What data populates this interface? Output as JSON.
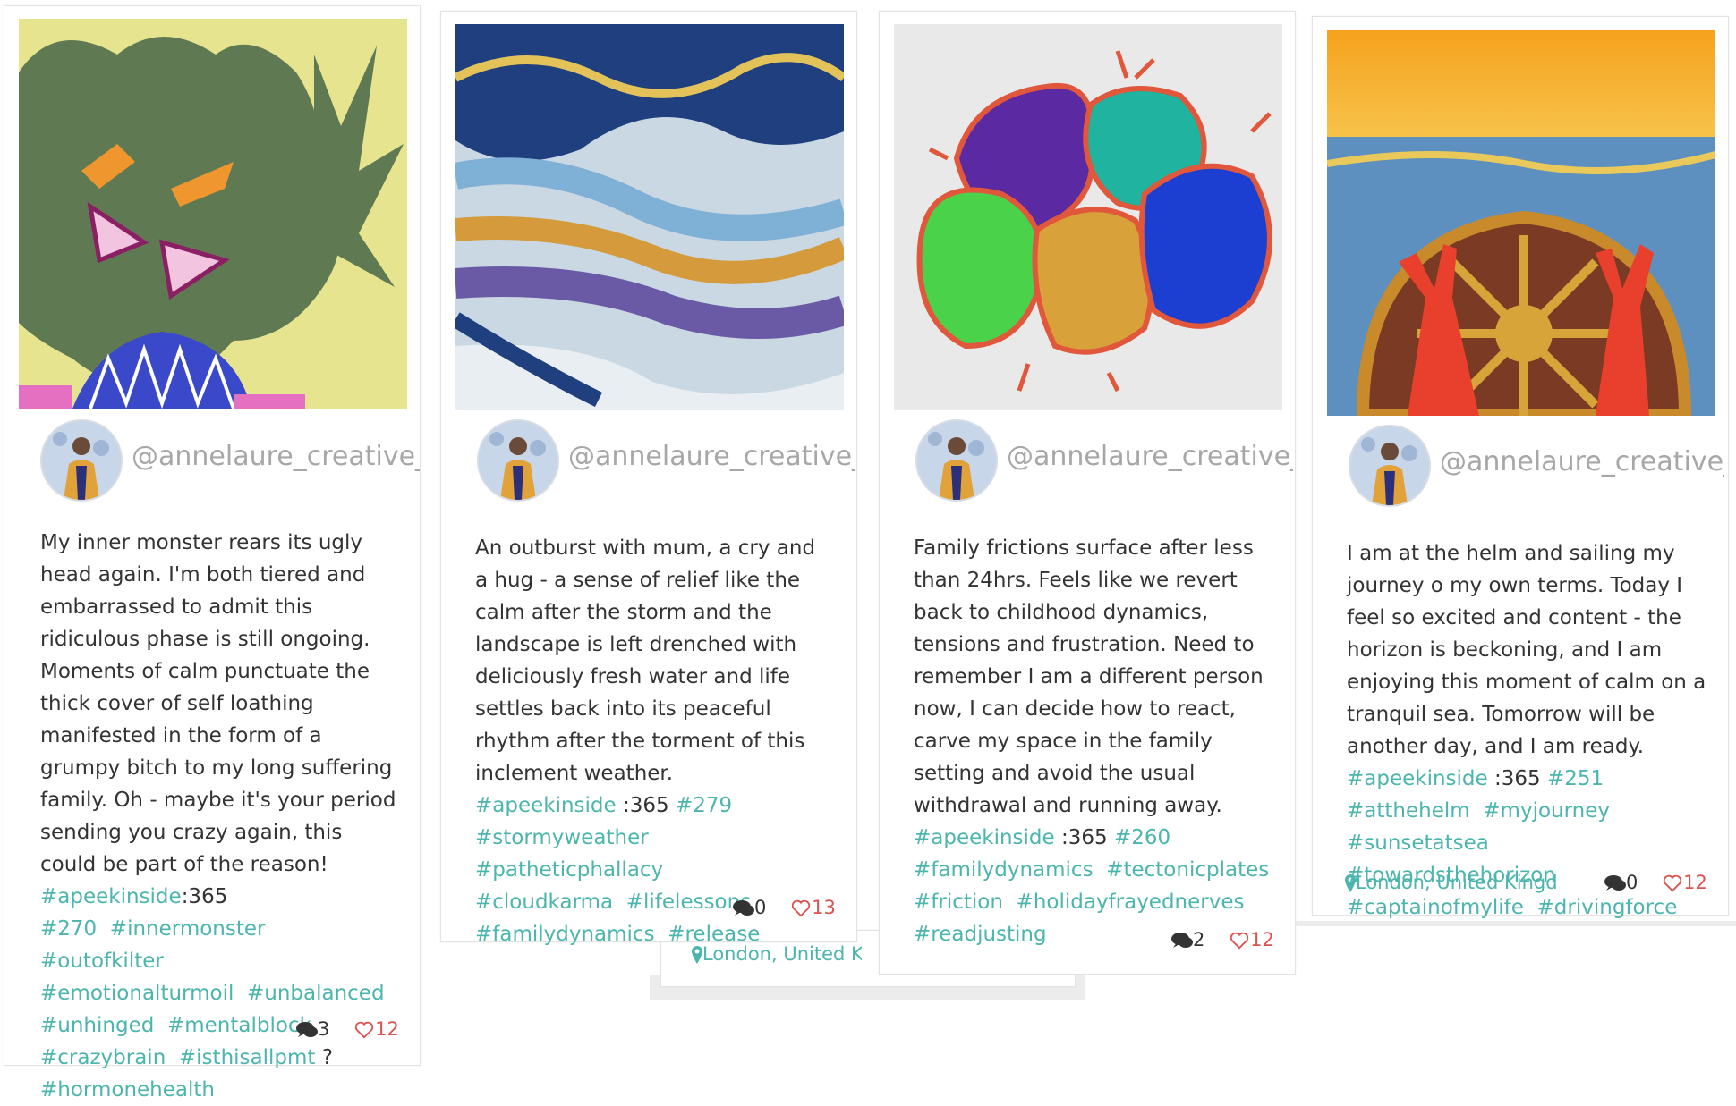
{
  "posts": [
    {
      "handle": "@annelaure_creative_exp",
      "caption_text": "My inner monster rears its ugly head again. I'm both tiered and embarrassed to admit this ridiculous phase is still ongoing. Moments of calm punctuate the thick cover of self loathing manifested in the form of a grumpy bitch to my long suffering family. Oh - maybe it's your period sending you crazy again, this could be part of the reason!",
      "tags_inline": "#apeekinside",
      "count_text": ":365",
      "tags_a": [
        "#270",
        "#innermonster",
        "#outofkilter"
      ],
      "tags_b": [
        "#emotionalturmoil",
        "#unbalanced"
      ],
      "tags_c": [
        "#unhinged",
        "#mentalblock"
      ],
      "tags_d": [
        "#crazybrain",
        "#isthisallpmt"
      ],
      "tags_d_suffix": "?",
      "tags_e": [
        "#hormonehealth"
      ],
      "comments": "3",
      "likes": "12"
    },
    {
      "handle": "@annelaure_creative_exp",
      "caption_text": "An outburst with mum, a cry and a hug - a sense of relief like the calm after the storm and the landscape is left drenched with deliciously fresh water and life settles back into its peaceful rhythm after the torment of this inclement weather.",
      "tag_lead": "#apeekinside",
      "count_text": ":365",
      "tags_a": [
        "#279"
      ],
      "tags_b": [
        "#stormyweather",
        "#patheticphallacy"
      ],
      "tags_c": [
        "#cloudkarma",
        "#lifelessons"
      ],
      "tags_d": [
        "#familydynamics",
        "#release"
      ],
      "comments": "0",
      "likes": "13",
      "location": "London, United Kin"
    },
    {
      "handle": "@annelaure_creative_exp",
      "caption_text": "Family frictions surface after less than 24hrs. Feels like we revert back to childhood dynamics, tensions and frustration. Need to remember I am a different person now, I can decide how to react, carve my space in the family setting and avoid the usual withdrawal and running away.",
      "tag_lead": "#apeekinside",
      "count_text": ":365",
      "tags_a": [
        "#260"
      ],
      "tags_b": [
        "#familydynamics",
        "#tectonicplates"
      ],
      "tags_c": [
        "#friction",
        "#holidayfrayednerves"
      ],
      "tags_d": [
        "#readjusting"
      ],
      "comments": "2",
      "likes": "12"
    },
    {
      "handle": "@annelaure_creative_exp",
      "caption_text": "I am at the helm and sailing my journey o my own terms. Today I feel so excited and content - the horizon is beckoning, and I am enjoying this moment of calm on a tranquil sea. Tomorrow will be another day, and I am ready.",
      "tags_inline": "#apeekinside",
      "count_text": ":365",
      "tags_a": [
        "#251"
      ],
      "tags_b": [
        "#atthehelm",
        "#myjourney"
      ],
      "tags_c": [
        "#sunsetatsea",
        "#towardsthehorizon"
      ],
      "tags_d": [
        "#captainofmylife",
        "#drivingforce"
      ],
      "comments": "0",
      "likes": "12",
      "location": "London, United Kingd..."
    }
  ],
  "colors": {
    "accent": "#4cb5ad",
    "like": "#d9534f",
    "handle": "#a7a7a7",
    "text": "#333333"
  },
  "icons": {
    "comment": "comments-icon",
    "like": "heart-icon",
    "location": "map-marker-icon"
  }
}
